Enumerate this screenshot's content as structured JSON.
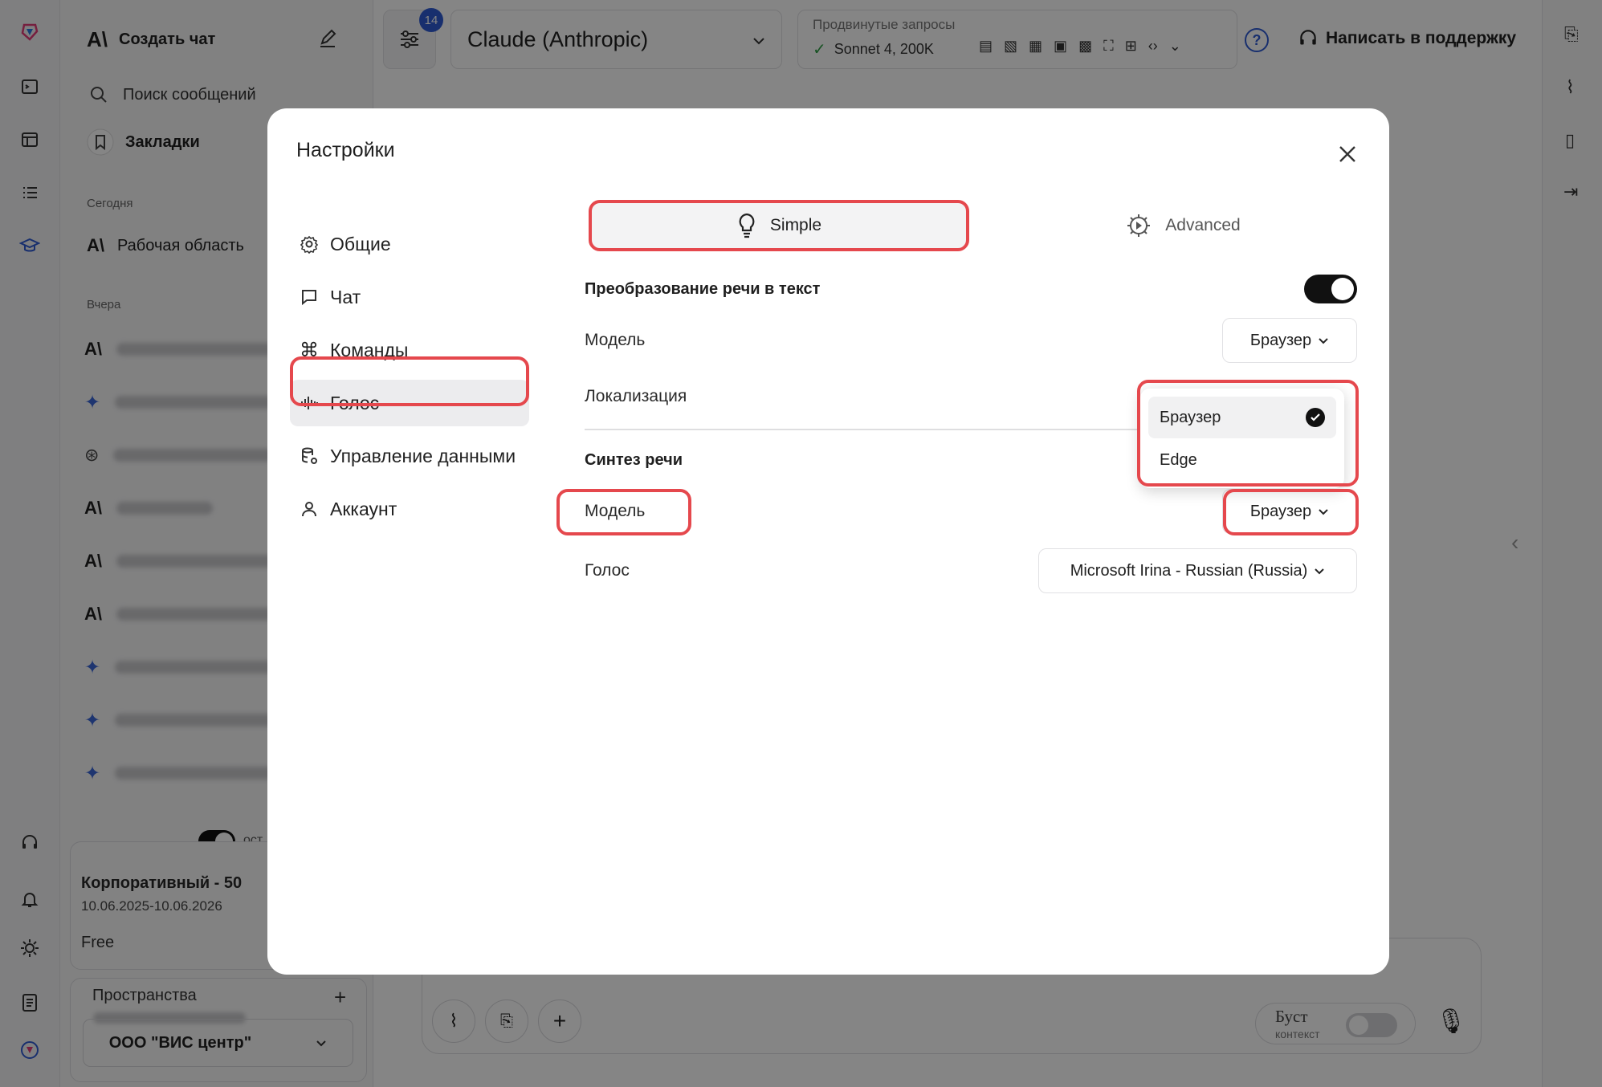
{
  "topbar": {
    "model_name": "Claude (Anthropic)",
    "badge_count": "14",
    "advanced_label": "Продвинутые запросы",
    "advanced_value": "Sonnet 4, 200K",
    "support_label": "Написать в поддержку"
  },
  "sidebar": {
    "new_chat": "Создать чат",
    "search": "Поиск сообщений",
    "bookmarks": "Закладки",
    "section_today": "Сегодня",
    "workspace": "Рабочая область",
    "section_yesterday": "Вчера",
    "plan_name": "Корпоративный - 50",
    "plan_dates": "10.06.2025-10.06.2026",
    "plan_tier": "Free",
    "toggle_label": "ост",
    "spaces_label": "Пространства",
    "org_name": "ООО \"ВИС центр\""
  },
  "composer": {
    "boost_label": "Буст",
    "boost_sub": "контекст"
  },
  "modal": {
    "title": "Настройки",
    "nav": [
      {
        "label": "Общие"
      },
      {
        "label": "Чат"
      },
      {
        "label": "Команды"
      },
      {
        "label": "Голос"
      },
      {
        "label": "Управление данными"
      },
      {
        "label": "Аккаунт"
      }
    ],
    "tabs": {
      "simple": "Simple",
      "advanced": "Advanced"
    },
    "stt": {
      "heading": "Преобразование речи в текст",
      "enabled": true,
      "model_label": "Модель",
      "model_value": "Браузер",
      "locale_label": "Локализация"
    },
    "dropdown_options": [
      {
        "label": "Браузер",
        "selected": true
      },
      {
        "label": "Edge",
        "selected": false
      }
    ],
    "tts": {
      "heading": "Синтез речи",
      "model_label": "Модель",
      "model_value": "Браузер",
      "voice_label": "Голос",
      "voice_value": "Microsoft Irina - Russian (Russia)"
    }
  },
  "colors": {
    "highlight": "#e5484d",
    "accent_blue": "#2f5bd3",
    "overlay": "rgba(0,0,0,0.48)"
  }
}
